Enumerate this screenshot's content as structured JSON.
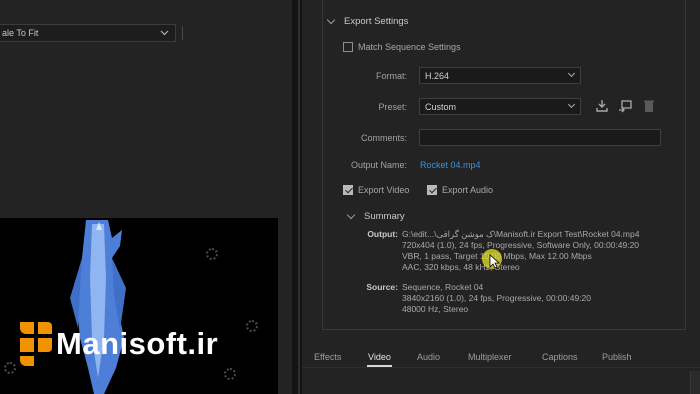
{
  "left": {
    "scale_option": "ale To Fit"
  },
  "logo": {
    "text": "Manisoft.ir",
    "accent": "#f39200"
  },
  "export_settings": {
    "section_title": "Export Settings",
    "match_sequence": {
      "label": "Match Sequence Settings",
      "checked": false
    },
    "format": {
      "label": "Format:",
      "value": "H.264"
    },
    "preset": {
      "label": "Preset:",
      "value": "Custom"
    },
    "comments": {
      "label": "Comments:",
      "value": ""
    },
    "output_name": {
      "label": "Output Name:",
      "value": "Rocket 04.mp4"
    },
    "export_video": {
      "label": "Export Video",
      "checked": true
    },
    "export_audio": {
      "label": "Export Audio",
      "checked": true
    }
  },
  "summary": {
    "title": "Summary",
    "output_label": "Output:",
    "output_lines": [
      "G:\\edit...\\ک موشن گرافی\\Manisoft.ir Export Test\\Rocket 04.mp4",
      "720x404 (1.0), 24 fps, Progressive, Software Only, 00:00:49:20",
      "VBR, 1 pass, Target 10.00 Mbps, Max 12.00 Mbps",
      "AAC, 320 kbps, 48 kHz, Stereo"
    ],
    "source_label": "Source:",
    "source_lines": [
      "Sequence, Rocket 04",
      "3840x2160 (1.0), 24 fps, Progressive, 00:00:49:20",
      "48000 Hz, Stereo"
    ]
  },
  "tabs": [
    "Effects",
    "Video",
    "Audio",
    "Multiplexer",
    "Captions",
    "Publish"
  ],
  "active_tab": "Video",
  "colors": {
    "link": "#3f8fdc",
    "panel": "#232323",
    "rocket": "#5b8fe0"
  }
}
